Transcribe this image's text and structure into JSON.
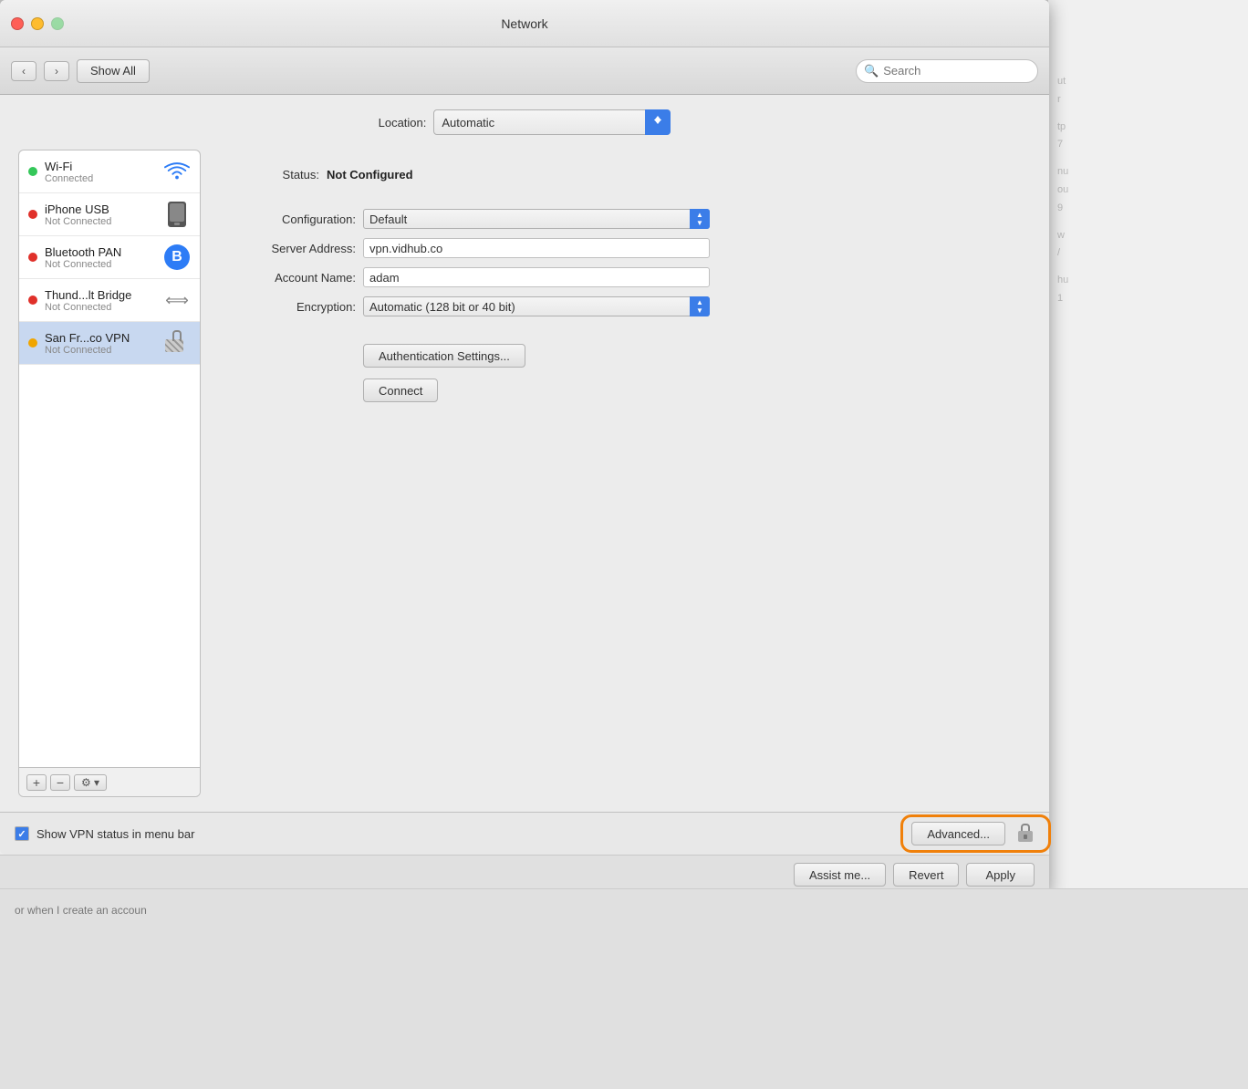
{
  "window": {
    "title": "Network",
    "titlebar": {
      "close": "●",
      "minimize": "●",
      "maximize": "●"
    }
  },
  "toolbar": {
    "back_label": "‹",
    "forward_label": "›",
    "show_all_label": "Show All",
    "search_placeholder": "Search"
  },
  "location": {
    "label": "Location:",
    "value": "Automatic"
  },
  "network_list": {
    "items": [
      {
        "name": "Wi-Fi",
        "status": "Connected",
        "dot": "green",
        "icon": "wifi"
      },
      {
        "name": "iPhone USB",
        "status": "Not Connected",
        "dot": "red",
        "icon": "phone"
      },
      {
        "name": "Bluetooth PAN",
        "status": "Not Connected",
        "dot": "red",
        "icon": "bluetooth"
      },
      {
        "name": "Thund...lt Bridge",
        "status": "Not Connected",
        "dot": "red",
        "icon": "bridge"
      },
      {
        "name": "San Fr...co VPN",
        "status": "Not Connected",
        "dot": "yellow",
        "icon": "vpn",
        "selected": true
      }
    ],
    "add_label": "+",
    "remove_label": "−",
    "gear_label": "⚙ ▾"
  },
  "detail": {
    "status_label": "Status:",
    "status_value": "Not Configured",
    "fields": [
      {
        "label": "Configuration:",
        "value": "Default",
        "type": "select"
      },
      {
        "label": "Server Address:",
        "value": "vpn.vidhub.co",
        "type": "input"
      },
      {
        "label": "Account Name:",
        "value": "adam",
        "type": "input"
      },
      {
        "label": "Encryption:",
        "value": "Automatic (128 bit or 40 bit)",
        "type": "select"
      }
    ],
    "auth_settings_label": "Authentication Settings...",
    "connect_label": "Connect"
  },
  "bottom": {
    "show_vpn_label": "Show VPN status in menu bar",
    "advanced_label": "Advanced...",
    "assist_label": "Assist me...",
    "revert_label": "Revert",
    "apply_label": "Apply"
  },
  "bg_text": "or when I create an accoun"
}
